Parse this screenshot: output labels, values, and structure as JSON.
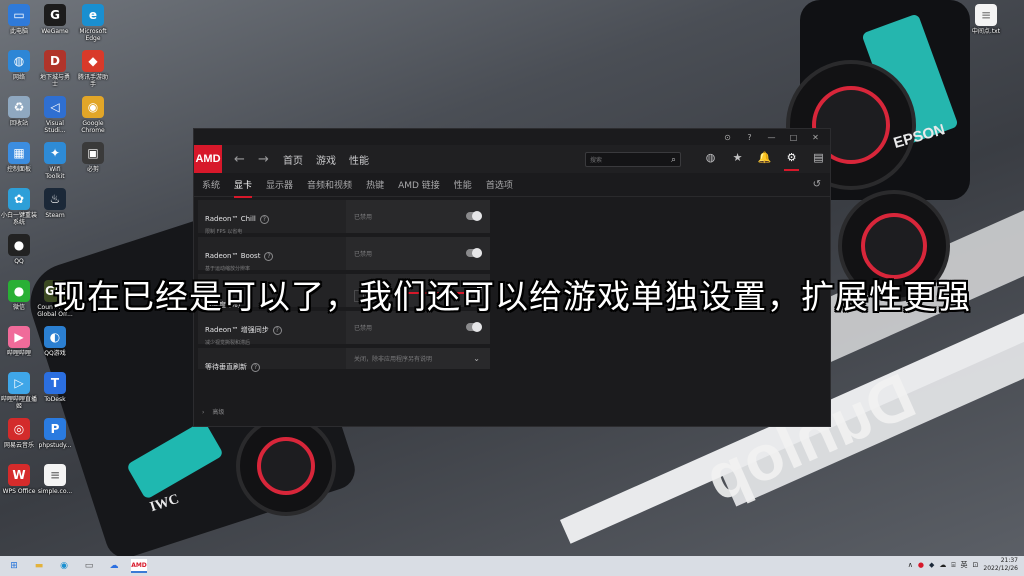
{
  "desktop": {
    "icons": [
      {
        "label": "此电脑",
        "color": "#2f7ad9",
        "glyph": "▭"
      },
      {
        "label": "WeGame",
        "color": "#1c1c1c",
        "glyph": "G"
      },
      {
        "label": "Microsoft\nEdge",
        "color": "#1a8fd0",
        "glyph": "e"
      },
      {
        "label": "网络",
        "color": "#2d86d6",
        "glyph": "◍"
      },
      {
        "label": "地下城与勇\n士",
        "color": "#b0342a",
        "glyph": "D"
      },
      {
        "label": "腾讯手游助\n手",
        "color": "#d93a2a",
        "glyph": "◆"
      },
      {
        "label": "回收站",
        "color": "#8fa8c0",
        "glyph": "♻"
      },
      {
        "label": "Visual\nStudi...",
        "color": "#2f6fd1",
        "glyph": "◁"
      },
      {
        "label": "Google\nChrome",
        "color": "#e2a628",
        "glyph": "◉"
      },
      {
        "label": "控制面板",
        "color": "#3c8de0",
        "glyph": "▦"
      },
      {
        "label": "Wifi\nToolkit",
        "color": "#2e8bd6",
        "glyph": "✦"
      },
      {
        "label": "必剪",
        "color": "#3a3a3a",
        "glyph": "▣"
      },
      {
        "label": "小白一键重装\n系统",
        "color": "#2e9fd8",
        "glyph": "✿"
      },
      {
        "label": "Steam",
        "color": "#1b2838",
        "glyph": "♨"
      },
      {
        "label": "QQ",
        "color": "#222222",
        "glyph": "●"
      },
      {
        "label": "微信",
        "color": "#29b035",
        "glyph": "●"
      },
      {
        "label": "Counter-S...\nGlobal Off...",
        "color": "#3c4a22",
        "glyph": "GO"
      },
      {
        "label": "哔哩哔哩",
        "color": "#f06b9a",
        "glyph": "▶"
      },
      {
        "label": "QQ游戏",
        "color": "#2b7fd1",
        "glyph": "◐"
      },
      {
        "label": "哔哩哔哩直播\n姬",
        "color": "#3fa6e8",
        "glyph": "▷"
      },
      {
        "label": "ToDesk",
        "color": "#2b6fe0",
        "glyph": "T"
      },
      {
        "label": "网易云音乐",
        "color": "#d32b2b",
        "glyph": "◎"
      },
      {
        "label": "phpstudy...",
        "color": "#2a7be0",
        "glyph": "P"
      },
      {
        "label": "WPS Office",
        "color": "#d52b2b",
        "glyph": "W"
      },
      {
        "label": "simple.co...",
        "color": "#f4f4f4",
        "glyph": "≡"
      }
    ],
    "right_icon_label": "中间点.txt",
    "wallpaper": {
      "epson": "EPSON",
      "iwc": "IWC",
      "track_text": "Dunlop"
    }
  },
  "amd": {
    "logo": "AMD",
    "titlebar": [
      "⊙",
      "?",
      "—",
      "□",
      "✕"
    ],
    "nav": {
      "back": "←",
      "forward": "→",
      "items": [
        "首页",
        "游戏",
        "性能"
      ]
    },
    "search_placeholder": "搜索",
    "top_icons": [
      "◍",
      "★",
      "🔔",
      "⚙",
      "▤"
    ],
    "tabs": [
      "系统",
      "显卡",
      "显示器",
      "音频和视频",
      "热键",
      "AMD 链接",
      "性能",
      "首选项"
    ],
    "active_tab": "显卡",
    "reset_glyph": "↺",
    "settings": [
      {
        "name": "Radeon™ Chill",
        "desc": "限制 FPS 以省电",
        "value": "已禁用"
      },
      {
        "name": "Radeon™ Boost",
        "desc": "基于运动缩放分辨率",
        "value": "已禁用"
      },
      {
        "name": "清晰度 (%)",
        "desc": "",
        "value": "100"
      },
      {
        "name": "Radeon™ 增强同步",
        "desc": "减少视觉撕裂和滞后",
        "value": "已禁用"
      },
      {
        "name": "等待垂直刷新",
        "desc": "",
        "value": "关闭，除非应用程序另有说明"
      }
    ],
    "sharpness_level": 1.0,
    "advanced": "高级"
  },
  "subtitle": "现在已经是可以了，我们还可以给游戏单独设置，扩展性更强",
  "taskbar": {
    "items": [
      "⊞",
      "▬",
      "◉",
      "▭",
      "☁",
      "AMD"
    ],
    "tray": [
      "∧",
      "●",
      "◆",
      "☁",
      "⌸",
      "英",
      "⊡"
    ],
    "time": "21:37",
    "date": "2022/12/26"
  }
}
